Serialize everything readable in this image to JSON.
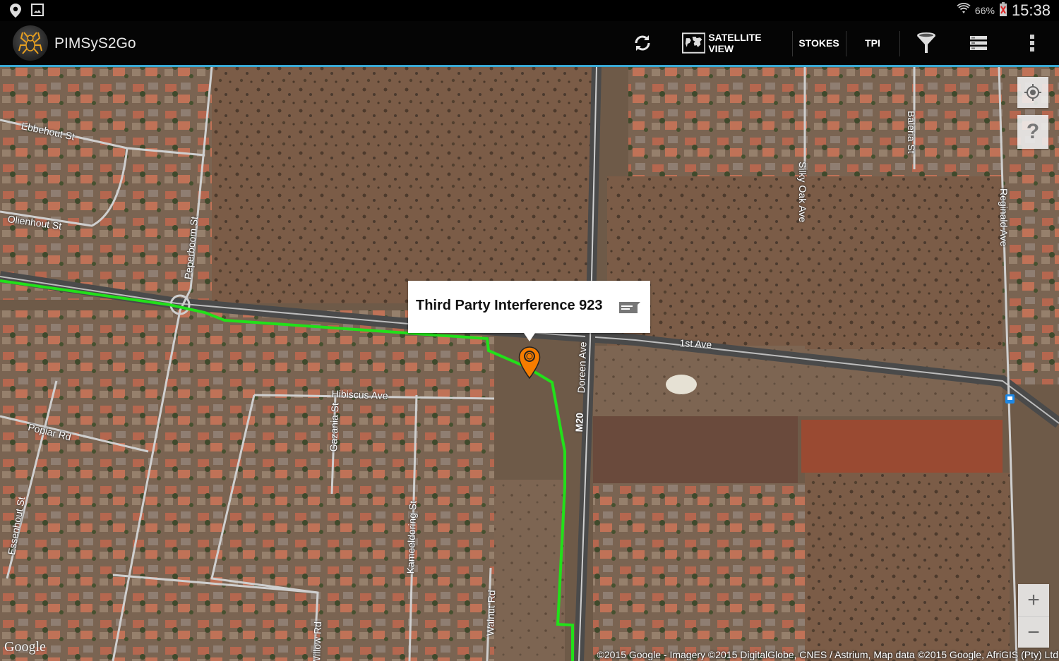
{
  "status_bar": {
    "battery_percent": "66%",
    "time": "15:38",
    "left_icons": [
      "location-icon",
      "image-icon"
    ],
    "right_icons": [
      "wifi-icon",
      "battery-icon"
    ]
  },
  "action_bar": {
    "app_title": "PIMSyS2Go",
    "buttons": {
      "refresh": "refresh-icon",
      "satellite_view": "SATELLITE VIEW",
      "stokes": "STOKES",
      "tpi": "TPI",
      "filter": "filter-icon",
      "list": "list-icon",
      "overflow": "overflow-menu-icon"
    },
    "accent_color": "#3aa9d4"
  },
  "map": {
    "info_window": {
      "title": "Third Party Interference 923",
      "icon": "message-icon"
    },
    "marker": {
      "color": "#f57c00"
    },
    "route_color": "#22e01a",
    "road_labels": {
      "ebbehout": "Ebbehout St",
      "olienhout": "Olienhout St",
      "peperboom": "Peperboom St",
      "silky_oak": "Silky Oak Ave",
      "baleria": "Baleria St",
      "reginald": "Reginald Ave",
      "first_ave": "1st Ave",
      "doreen": "Doreen Ave",
      "m20": "M20",
      "hibiscus": "Hibiscus Ave",
      "gazania": "Gazania St",
      "poplar": "Poplar Rd",
      "essenhout": "Essenhout St",
      "kameeldoring": "Kameeldoring St",
      "walnut": "Walnut Rd",
      "willow": "Willow Rd"
    },
    "controls": {
      "my_location": "my-location-icon",
      "help": "?",
      "zoom_in": "+",
      "zoom_out": "−"
    },
    "google_logo": "Google",
    "attribution": "©2015 Google - Imagery ©2015 DigitalGlobe, CNES / Astrium, Map data ©2015 Google, AfriGIS (Pty) Ltd"
  }
}
